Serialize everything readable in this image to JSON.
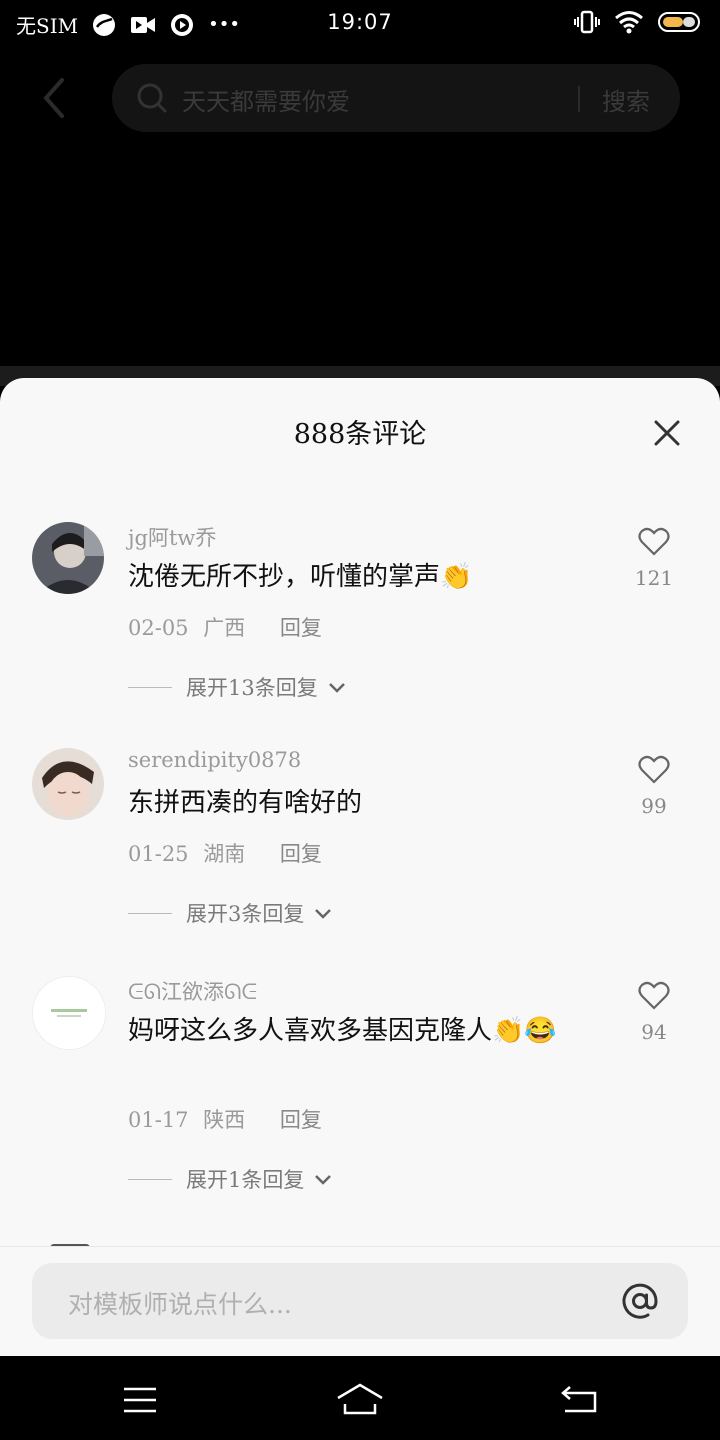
{
  "status_bar": {
    "carrier": "无SIM",
    "time": "19:07",
    "more": "•••"
  },
  "search": {
    "placeholder": "天天都需要你爱",
    "button_label": "搜索"
  },
  "sheet": {
    "title": "888条评论"
  },
  "comments": [
    {
      "username": "jg阿tw乔",
      "text": "沈倦无所不抄，听懂的掌声👏",
      "date": "02-05",
      "region": "广西",
      "reply_label": "回复",
      "expand_label": "展开13条回复",
      "likes": "121"
    },
    {
      "username": "serendipity0878",
      "text": "东拼西凑的有啥好的",
      "date": "01-25",
      "region": "湖南",
      "reply_label": "回复",
      "expand_label": "展开3条回复",
      "likes": "99"
    },
    {
      "username": "ᕮᘏ江欲添ᘏᕮ",
      "text": "妈呀这么多人喜欢多基因克隆人👏😂",
      "date": "01-17",
      "region": "陕西",
      "reply_label": "回复",
      "expand_label": "展开1条回复",
      "likes": "94"
    }
  ],
  "input": {
    "placeholder": "对模板师说点什么..."
  },
  "colors": {
    "sheet_bg": "#f8f8f8",
    "input_bg": "#ebebeb",
    "meta_gray": "#9a9a9a"
  }
}
